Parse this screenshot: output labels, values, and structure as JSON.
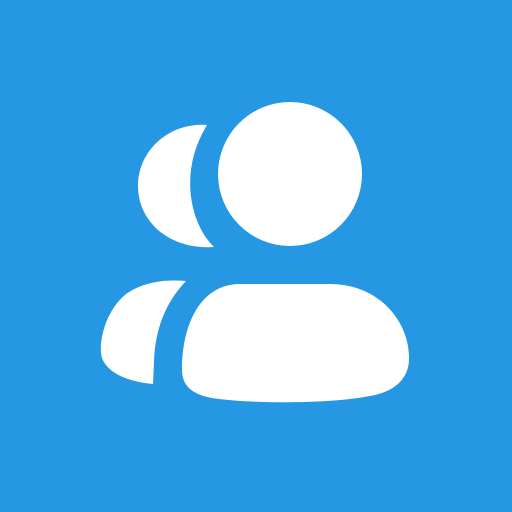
{
  "icon": {
    "name": "users-group-icon",
    "background_color": "#2597e3",
    "foreground_color": "#ffffff"
  }
}
